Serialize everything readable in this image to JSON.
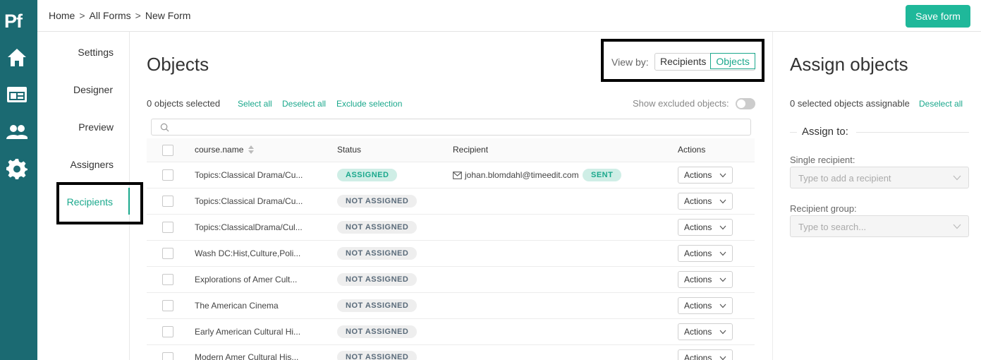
{
  "app": {
    "logo": "Pf"
  },
  "rail": {
    "icons": [
      "home-icon",
      "form-icon",
      "users-icon",
      "gear-icon"
    ],
    "color": "#1b6a72"
  },
  "breadcrumb": {
    "items": [
      "Home",
      "All Forms",
      "New Form"
    ],
    "separator": ">"
  },
  "toolbar": {
    "save_label": "Save form"
  },
  "subnav": {
    "items": [
      {
        "label": "Settings"
      },
      {
        "label": "Designer"
      },
      {
        "label": "Preview"
      },
      {
        "label": "Assigners"
      },
      {
        "label": "Recipients"
      }
    ],
    "active": "Recipients"
  },
  "main": {
    "title": "Objects",
    "view_by_label": "View by:",
    "view_options": [
      "Recipients",
      "Objects"
    ],
    "view_selected": "Objects",
    "selected_count": "0 objects selected",
    "select_all": "Select all",
    "deselect_all": "Deselect all",
    "exclude_selection": "Exclude selection",
    "show_excluded": "Show excluded objects:",
    "columns": [
      "course.name",
      "Status",
      "Recipient",
      "Actions"
    ],
    "rows": [
      {
        "name": "Topics:Classical Drama/Cu...",
        "status": "ASSIGNED",
        "recipient": "johan.blomdahl@timeedit.com",
        "sent": "SENT",
        "action": "Actions"
      },
      {
        "name": "Topics:Classical Drama/Cu...",
        "status": "NOT ASSIGNED",
        "action": "Actions"
      },
      {
        "name": "Topics:ClassicalDrama/Cul...",
        "status": "NOT ASSIGNED",
        "action": "Actions"
      },
      {
        "name": "Wash DC:Hist,Culture,Poli...",
        "status": "NOT ASSIGNED",
        "action": "Actions"
      },
      {
        "name": "Explorations of Amer Cult...",
        "status": "NOT ASSIGNED",
        "action": "Actions"
      },
      {
        "name": "The American Cinema",
        "status": "NOT ASSIGNED",
        "action": "Actions"
      },
      {
        "name": "Early American Cultural Hi...",
        "status": "NOT ASSIGNED",
        "action": "Actions"
      },
      {
        "name": "Modern Amer Cultural His...",
        "status": "NOT ASSIGNED",
        "action": "Actions"
      }
    ]
  },
  "right": {
    "title": "Assign objects",
    "count": "0 selected objects assignable",
    "deselect_all": "Deselect all",
    "assign_to": "Assign to:",
    "single_label": "Single recipient:",
    "single_placeholder": "Type to add a recipient",
    "group_label": "Recipient group:",
    "group_placeholder": "Type to search..."
  },
  "colors": {
    "accent": "#1aa88c",
    "save": "#1fb89a",
    "rail": "#1b6a72"
  }
}
